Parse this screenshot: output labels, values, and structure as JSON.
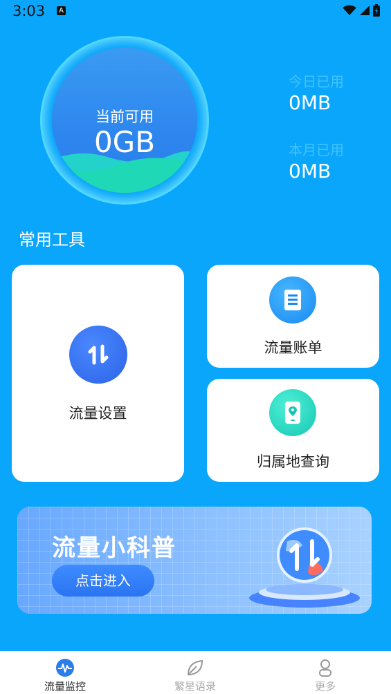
{
  "status_bar": {
    "time": "3:03",
    "notif_badge": "A"
  },
  "gauge": {
    "label": "当前可用",
    "value": "0GB"
  },
  "stats": [
    {
      "label": "今日已用",
      "value": "0MB"
    },
    {
      "label": "本月已用",
      "value": "0MB"
    }
  ],
  "section_title": "常用工具",
  "tools": {
    "settings": {
      "label": "流量设置",
      "icon": "data-transfer-icon"
    },
    "bill": {
      "label": "流量账单",
      "icon": "document-icon"
    },
    "location": {
      "label": "归属地查询",
      "icon": "phone-location-icon"
    }
  },
  "banner": {
    "title": "流量小科普",
    "button": "点击进入",
    "icon": "globe-data-icon"
  },
  "tabs": [
    {
      "label": "流量监控",
      "icon": "pulse-icon",
      "active": true
    },
    {
      "label": "繁星语录",
      "icon": "leaf-icon",
      "active": false
    },
    {
      "label": "更多",
      "icon": "person-icon",
      "active": false
    }
  ],
  "colors": {
    "background": "#0aa6fb",
    "accent": "#2b7de8",
    "tab_active": "#222222",
    "tab_inactive": "#aaaaaa"
  }
}
